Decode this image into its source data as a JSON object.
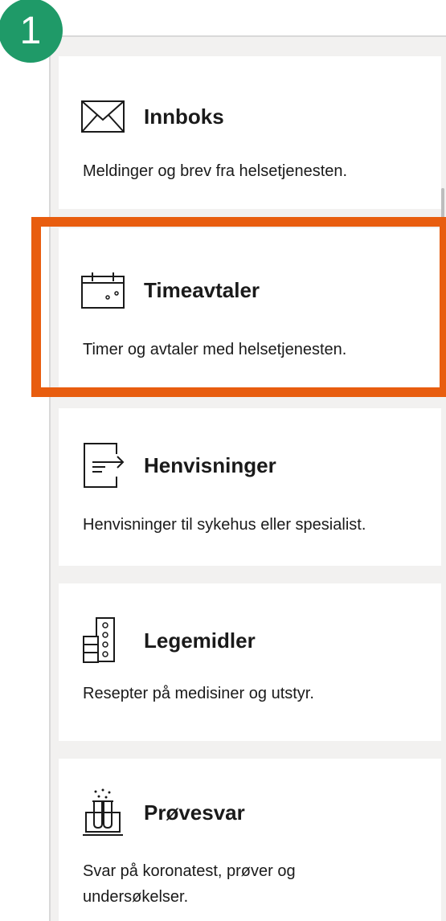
{
  "step": {
    "number": "1",
    "badge_color": "#1f9a68"
  },
  "highlight_color": "#e85d0f",
  "cards": [
    {
      "icon": "envelope-icon",
      "title": "Innboks",
      "description": "Meldinger og brev fra helsetjenesten."
    },
    {
      "icon": "calendar-icon",
      "title": "Timeavtaler",
      "description": "Timer og avtaler med helsetjenesten."
    },
    {
      "icon": "referral-icon",
      "title": "Henvisninger",
      "description": "Henvisninger til sykehus eller spesialist."
    },
    {
      "icon": "medicine-icon",
      "title": "Legemidler",
      "description": "Resepter på medisiner og utstyr."
    },
    {
      "icon": "test-tubes-icon",
      "title": "Prøvesvar",
      "description": "Svar på koronatest, prøver og undersøkelser."
    }
  ]
}
